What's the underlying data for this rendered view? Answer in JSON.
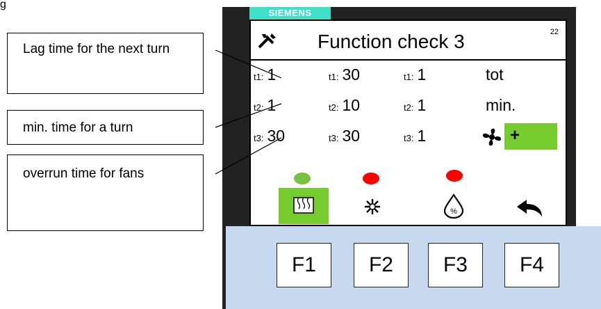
{
  "figure_label": "g",
  "callouts": [
    {
      "text": "Lag time for the next turn"
    },
    {
      "text": "min. time for a turn"
    },
    {
      "text": "overrun time for fans"
    }
  ],
  "device": {
    "brand": "SIEMENS",
    "screen": {
      "title": "Function check 3",
      "page_number": "22",
      "rows": [
        [
          {
            "sub": "t1:",
            "value": "1"
          },
          {
            "sub": "t1:",
            "value": "30"
          },
          {
            "sub": "t1:",
            "value": "1"
          },
          {
            "sub": "",
            "value": "tot"
          }
        ],
        [
          {
            "sub": "t2:",
            "value": "1"
          },
          {
            "sub": "t2:",
            "value": "10"
          },
          {
            "sub": "t2:",
            "value": "1"
          },
          {
            "sub": "",
            "value": "min."
          }
        ],
        [
          {
            "sub": "t3:",
            "value": "30"
          },
          {
            "sub": "t3:",
            "value": "30"
          },
          {
            "sub": "t3:",
            "value": "1"
          }
        ]
      ],
      "fan_plus_label": "+",
      "indicators": [
        {
          "color": "#7ac142"
        },
        {
          "color": "#ff0000"
        },
        {
          "color": "#ff0000"
        }
      ],
      "icons": [
        "heater-icon",
        "snowflake-icon",
        "humidity-drop-icon",
        "back-arrow-icon"
      ],
      "accent_color": "#76cc2f"
    },
    "function_keys": [
      "F1",
      "F2",
      "F3",
      "F4"
    ]
  }
}
